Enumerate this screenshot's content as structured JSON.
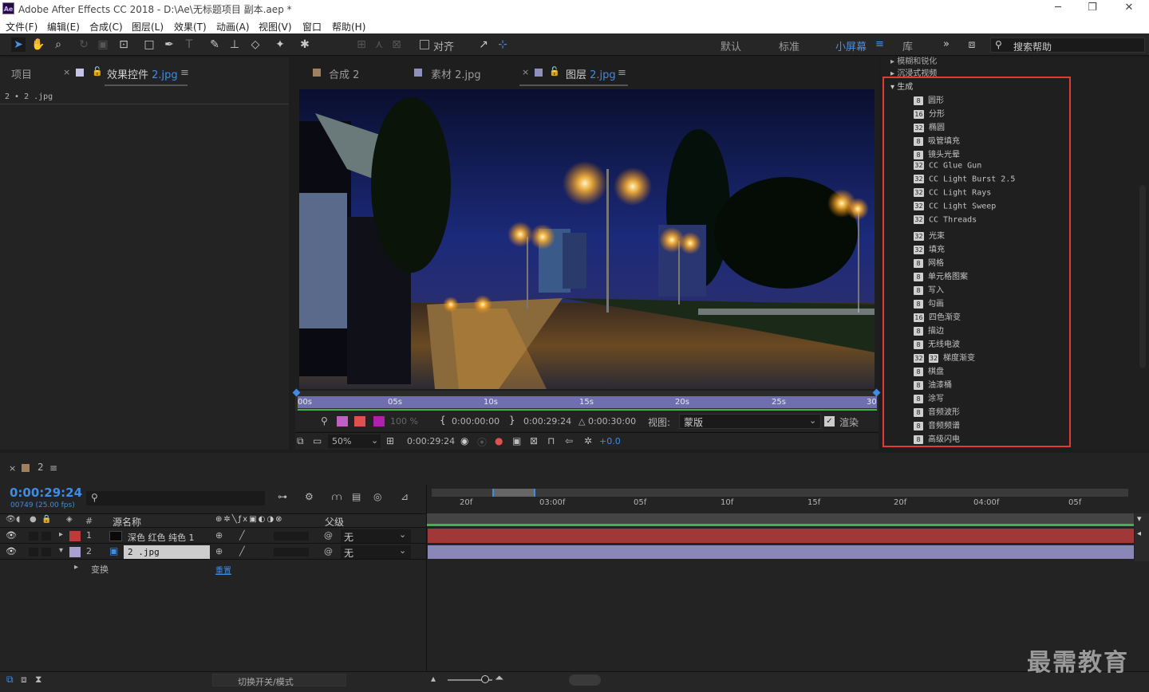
{
  "window": {
    "title": "Adobe After Effects CC 2018 - D:\\Ae\\无标题项目 副本.aep *",
    "app_icon": "Ae",
    "min": "─",
    "max": "❐",
    "close": "✕"
  },
  "menu": [
    "文件(F)",
    "编辑(E)",
    "合成(C)",
    "图层(L)",
    "效果(T)",
    "动画(A)",
    "视图(V)",
    "窗口",
    "帮助(H)"
  ],
  "toolbar": {
    "align_label": "对齐",
    "workspaces": [
      "默认",
      "标准",
      "小屏幕",
      "库"
    ],
    "active_workspace": "小屏幕",
    "search_placeholder": "搜索帮助"
  },
  "left_panel": {
    "tab_project": "项目",
    "tab_effects": "效果控件",
    "tab_effects_file": "2.jpg",
    "layer_line": "2 • 2 .jpg"
  },
  "viewer": {
    "tabs": [
      {
        "label": "合成",
        "file": "2",
        "color": "#a08060"
      },
      {
        "label": "素材",
        "file": "2.jpg",
        "color": "#9090c0"
      },
      {
        "label": "图层",
        "file": "2.jpg",
        "color": "#9090c0"
      }
    ],
    "ruler_ticks": [
      "00s",
      "05s",
      "10s",
      "15s",
      "20s",
      "25s",
      "30"
    ],
    "in_time": "0:00:00:00",
    "out_time": "0:00:29:24",
    "duration": "△ 0:00:30:00",
    "view_label": "视图:",
    "view_value": "蒙版",
    "render_label": "渲染",
    "opacity": "100 %",
    "zoom": "50%",
    "timecode": "0:00:29:24",
    "exposure": "+0.0"
  },
  "effects": {
    "above": [
      "模糊和锐化",
      "沉浸式视频"
    ],
    "category": "生成",
    "items": [
      {
        "label": "圆形",
        "badge": "8"
      },
      {
        "label": "分形",
        "badge": "16"
      },
      {
        "label": "椭圆",
        "badge": "32"
      },
      {
        "label": "吸管填充",
        "badge": "8"
      },
      {
        "label": "镜头光晕",
        "badge": "8"
      },
      {
        "label": "CC Glue Gun",
        "badge": "32"
      },
      {
        "label": "CC Light Burst 2.5",
        "badge": "32"
      },
      {
        "label": "CC Light Rays",
        "badge": "32"
      },
      {
        "label": "CC Light Sweep",
        "badge": "32"
      },
      {
        "label": "CC Threads",
        "badge": "32"
      },
      {
        "label": "光束",
        "badge": "32"
      },
      {
        "label": "填充",
        "badge": "32"
      },
      {
        "label": "网格",
        "badge": "8"
      },
      {
        "label": "单元格图案",
        "badge": "8"
      },
      {
        "label": "写入",
        "badge": "8"
      },
      {
        "label": "勾画",
        "badge": "8"
      },
      {
        "label": "四色渐变",
        "badge": "16"
      },
      {
        "label": "描边",
        "badge": "8"
      },
      {
        "label": "无线电波",
        "badge": "8"
      },
      {
        "label": "梯度渐变",
        "badge": "32"
      },
      {
        "label": "棋盘",
        "badge": "8"
      },
      {
        "label": "油漆桶",
        "badge": "8"
      },
      {
        "label": "涂写",
        "badge": "8"
      },
      {
        "label": "音频波形",
        "badge": "8"
      },
      {
        "label": "音频频谱",
        "badge": "8"
      },
      {
        "label": "高级闪电",
        "badge": "8"
      }
    ]
  },
  "timeline": {
    "comp_name": "2",
    "timecode": "0:00:29:24",
    "frames": "00749 (25.00 fps)",
    "col_num": "#",
    "col_source": "源名称",
    "col_parent": "父级",
    "ruler": [
      "20f",
      "03:00f",
      "05f",
      "10f",
      "15f",
      "20f",
      "04:00f",
      "05f"
    ],
    "layers": [
      {
        "num": "1",
        "name": "深色 红色 纯色 1",
        "parent": "无",
        "label_color": "#c03a3a"
      },
      {
        "num": "2",
        "name": "2 .jpg",
        "parent": "无",
        "label_color": "#a8a0d0"
      }
    ],
    "transform_label": "变换",
    "transform_reset": "重置",
    "toggle_label": "切换开关/模式"
  },
  "watermark": "最需教育"
}
